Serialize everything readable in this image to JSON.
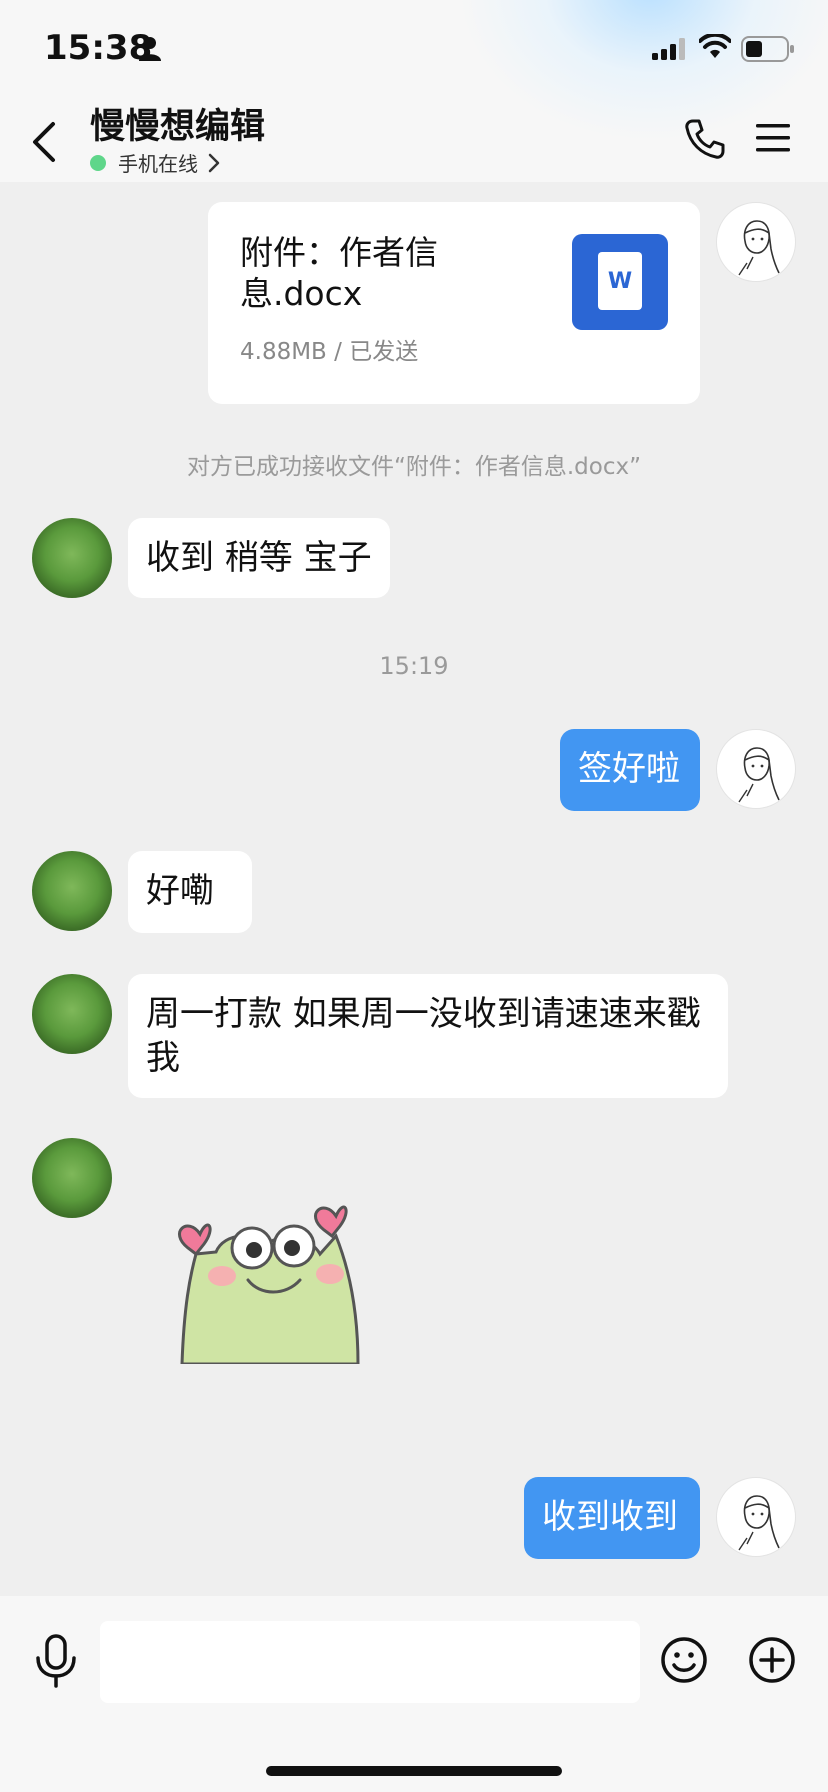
{
  "status_bar": {
    "time": "15:38"
  },
  "header": {
    "title": "慢慢想编辑",
    "status_text": "手机在线"
  },
  "messages": {
    "file": {
      "name": "附件：作者信息.docx",
      "meta": "4.88MB / 已发送",
      "icon_letter": "W"
    },
    "system_note": "对方已成功接收文件“附件：作者信息.docx”",
    "peer_1": "收到 稍等 宝子",
    "timestamp": "15:19",
    "me_1": "签好啦",
    "peer_2": "好嘞",
    "peer_3": "周一打款 如果周一没收到请速速来戳我",
    "me_2": "收到收到"
  },
  "input": {
    "value": "",
    "placeholder": ""
  },
  "colors": {
    "accent": "#4296f2",
    "online": "#5fd68a",
    "word_icon": "#2b66d4",
    "background": "#efefef"
  }
}
